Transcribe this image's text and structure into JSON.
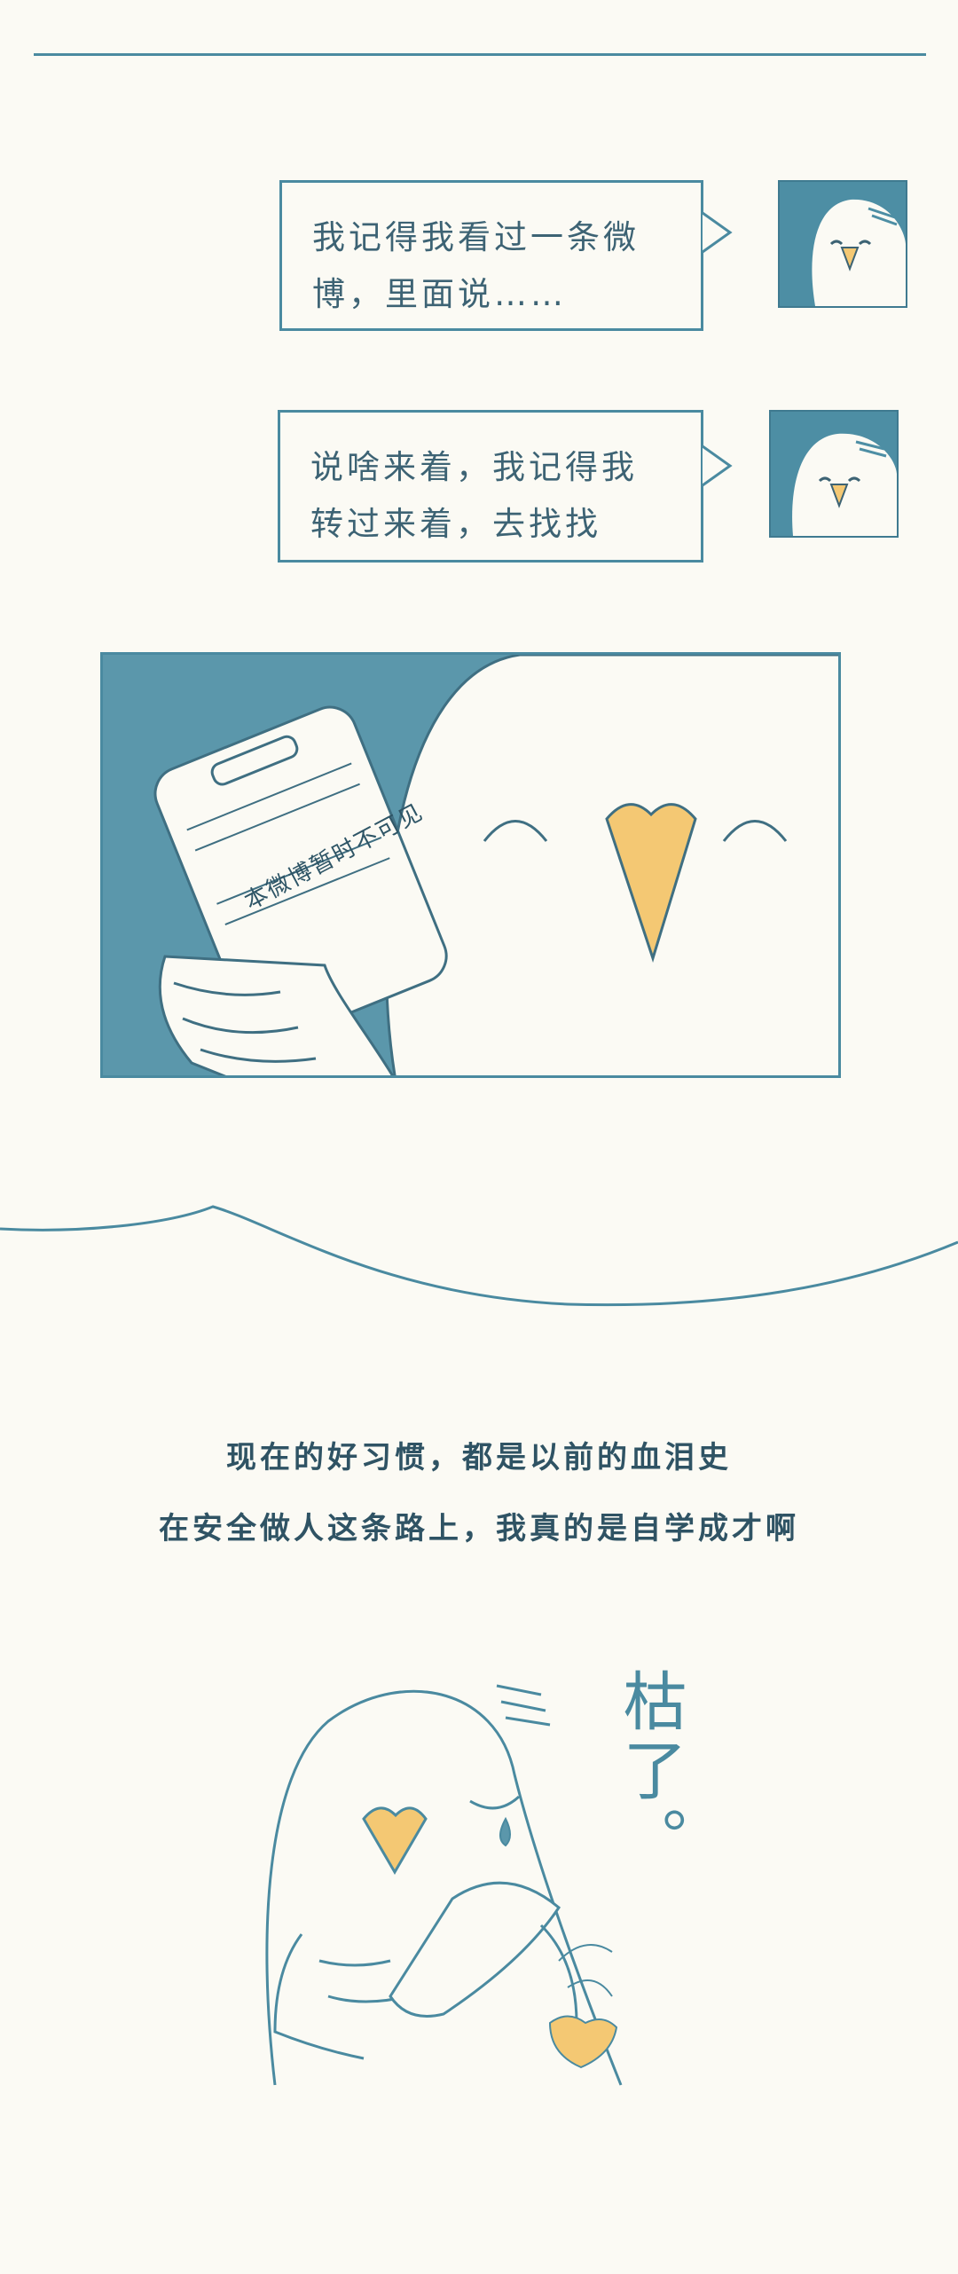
{
  "bubbles": [
    {
      "text": "我记得我看过一条微\n博，里面说……"
    },
    {
      "text": "说啥来着，我记得我\n转过来着，去找找"
    }
  ],
  "panel": {
    "phone_notice": "本微博暂时不可见"
  },
  "caption": {
    "line1": "现在的好习惯，都是以前的血泪史",
    "line2": "在安全做人这条路上，我真的是自学成才啊"
  },
  "handwritten": "枯了。",
  "colors": {
    "accent": "#4a8aa0",
    "dark_text": "#2f5364",
    "beak": "#f4c873",
    "background": "#fbfaf4"
  }
}
